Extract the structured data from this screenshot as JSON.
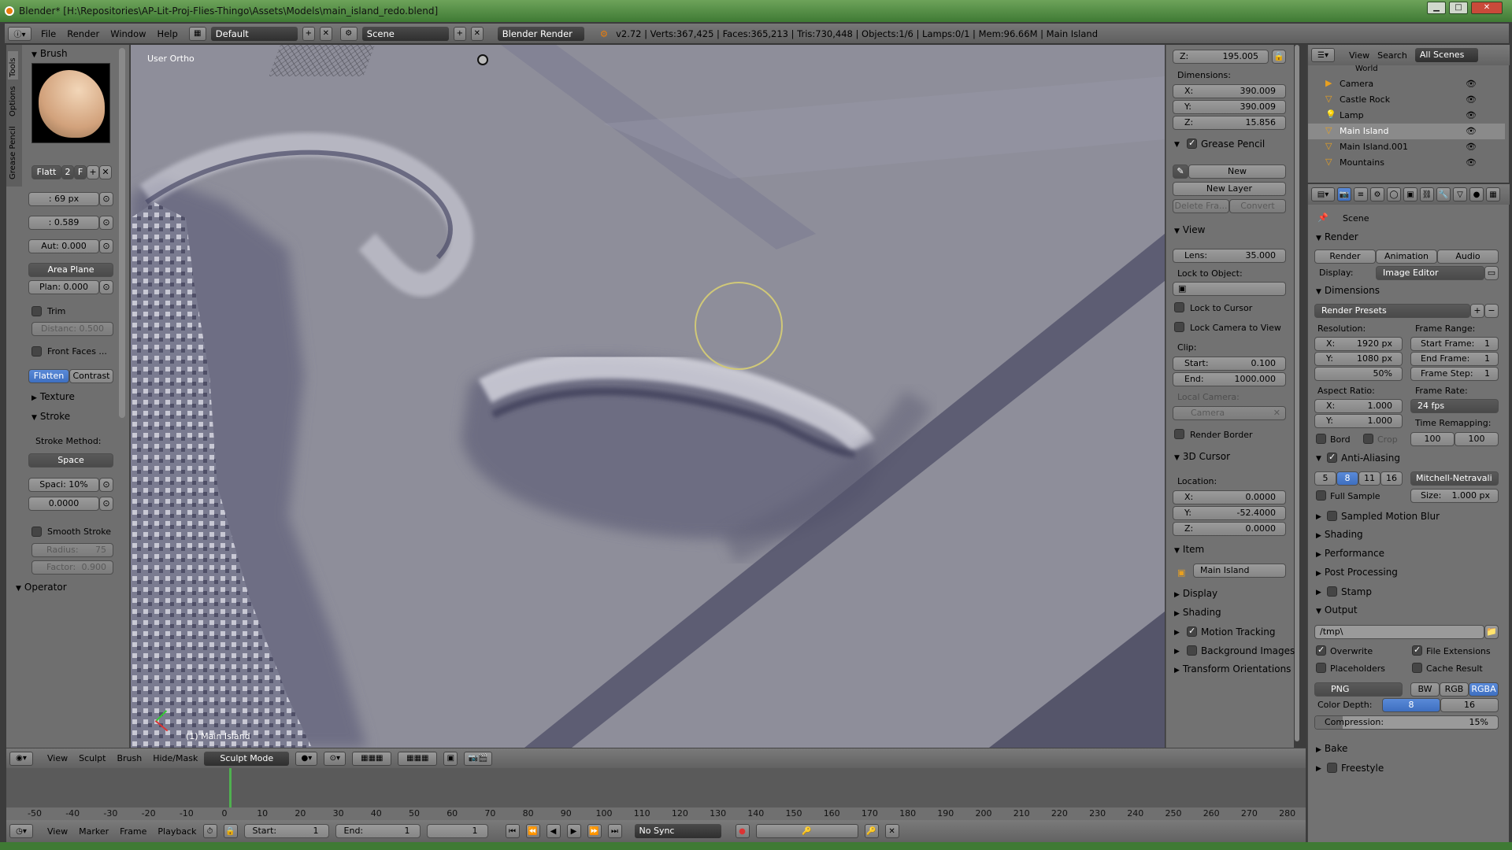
{
  "window": {
    "title": "Blender* [H:\\Repositories\\AP-Lit-Proj-Flies-Thingo\\Assets\\Models\\main_island_redo.blend]",
    "min": "▁",
    "max": "□",
    "close": "✕"
  },
  "menu": {
    "items": [
      "File",
      "Render",
      "Window",
      "Help"
    ],
    "layout": "Default",
    "scene": "Scene",
    "engine": "Blender Render",
    "stats": "v2.72 | Verts:367,425 | Faces:365,213 | Tris:730,448 | Objects:1/6 | Lamps:0/1 | Mem:96.66M | Main Island"
  },
  "tools": {
    "tabs": [
      "Tools",
      "Options",
      "Grease Pencil"
    ],
    "brush_section": "Brush",
    "brush_name": "Flatt",
    "brush_users": "2",
    "brush_fake": "F",
    "radius": ": 69 px",
    "strength": ": 0.589",
    "autosmooth": "Aut: 0.000",
    "plane": "Area Plane",
    "plane_offset": "Plan: 0.000",
    "trim": "Trim",
    "distance": "Distanc: 0.500",
    "front_faces": "Front Faces ...",
    "flatten": "Flatten",
    "contrast": "Contrast",
    "texture": "Texture",
    "stroke": "Stroke",
    "stroke_method_label": "Stroke Method:",
    "stroke_method": "Space",
    "spacing": "Spaci: 10%",
    "jitter": "0.0000",
    "smooth_stroke": "Smooth Stroke",
    "smooth_radius": "Radius:",
    "smooth_radius_val": "75",
    "smooth_factor": "Factor:",
    "smooth_factor_val": "0.900",
    "operator": "Operator"
  },
  "viewport": {
    "view_label": "User Ortho",
    "object_label": "(1) Main Island"
  },
  "npanel": {
    "z_loc": "Z:",
    "z_loc_val": "195.005",
    "dimensions": "Dimensions:",
    "dims": [
      {
        "axis": "X:",
        "val": "390.009"
      },
      {
        "axis": "Y:",
        "val": "390.009"
      },
      {
        "axis": "Z:",
        "val": "15.856"
      }
    ],
    "grease_pencil": "Grease Pencil",
    "gp_new": "New",
    "gp_new_layer": "New Layer",
    "gp_delete": "Delete Fra...",
    "gp_convert": "Convert",
    "view": "View",
    "lens": "Lens:",
    "lens_val": "35.000",
    "lock_object": "Lock to Object:",
    "lock_cursor": "Lock to Cursor",
    "lock_camera": "Lock Camera to View",
    "clip": "Clip:",
    "clip_start": "Start:",
    "clip_start_val": "0.100",
    "clip_end": "End:",
    "clip_end_val": "1000.000",
    "local_camera": "Local Camera:",
    "camera": "Camera",
    "render_border": "Render Border",
    "cursor3d": "3D Cursor",
    "location": "Location:",
    "cursor": [
      {
        "axis": "X:",
        "val": "0.0000"
      },
      {
        "axis": "Y:",
        "val": "-52.4000"
      },
      {
        "axis": "Z:",
        "val": "0.0000"
      }
    ],
    "item": "Item",
    "item_name": "Main Island",
    "display": "Display",
    "shading": "Shading",
    "motion_tracking": "Motion Tracking",
    "background_images": "Background Images",
    "transform_orientations": "Transform Orientations"
  },
  "outliner": {
    "view": "View",
    "search": "Search",
    "filter": "All Scenes",
    "world": "World",
    "items": [
      "Camera",
      "Castle Rock",
      "Lamp",
      "Main Island",
      "Main Island.001",
      "Mountains"
    ]
  },
  "properties": {
    "scene": "Scene",
    "render": "Render",
    "render_btn": "Render",
    "animation_btn": "Animation",
    "audio_btn": "Audio",
    "display": "Display:",
    "display_val": "Image Editor",
    "dimensions": "Dimensions",
    "render_presets": "Render Presets",
    "resolution": "Resolution:",
    "res_x": "X:",
    "res_x_val": "1920 px",
    "res_y": "Y:",
    "res_y_val": "1080 px",
    "res_pct": "50%",
    "frame_range": "Frame Range:",
    "start_frame": "Start Frame:",
    "start_frame_val": "1",
    "end_frame": "End Frame:",
    "end_frame_val": "1",
    "frame_step": "Frame Step:",
    "frame_step_val": "1",
    "aspect": "Aspect Ratio:",
    "asp_x": "X:",
    "asp_x_val": "1.000",
    "asp_y": "Y:",
    "asp_y_val": "1.000",
    "frame_rate": "Frame Rate:",
    "fps": "24 fps",
    "time_remap": "Time Remapping:",
    "remap_old": "100",
    "remap_new": "100",
    "bord": "Bord",
    "crop": "Crop",
    "anti_aliasing": "Anti-Aliasing",
    "aa_samples": [
      "5",
      "8",
      "11",
      "16"
    ],
    "aa_filter": "Mitchell-Netravali",
    "full_sample": "Full Sample",
    "size": "Size:",
    "size_val": "1.000 px",
    "sampled_motion_blur": "Sampled Motion Blur",
    "shading": "Shading",
    "performance": "Performance",
    "post_processing": "Post Processing",
    "stamp": "Stamp",
    "output": "Output",
    "output_path": "/tmp\\",
    "overwrite": "Overwrite",
    "file_ext": "File Extensions",
    "placeholders": "Placeholders",
    "cache_result": "Cache Result",
    "format": "PNG",
    "bw": "BW",
    "rgb": "RGB",
    "rgba": "RGBA",
    "color_depth": "Color Depth:",
    "cd8": "8",
    "cd16": "16",
    "compression": "Compression:",
    "compression_val": "15%",
    "compression_level": 0.15,
    "bake": "Bake",
    "freestyle": "Freestyle"
  },
  "header3d": {
    "view": "View",
    "sculpt": "Sculpt",
    "brush": "Brush",
    "hidemask": "Hide/Mask",
    "mode": "Sculpt Mode"
  },
  "timeline": {
    "ticks": [
      "-50",
      "-40",
      "-30",
      "-20",
      "-10",
      "0",
      "10",
      "20",
      "30",
      "40",
      "50",
      "60",
      "70",
      "80",
      "90",
      "100",
      "110",
      "120",
      "130",
      "140",
      "150",
      "160",
      "170",
      "180",
      "190",
      "200",
      "210",
      "220",
      "230",
      "240",
      "250",
      "260",
      "270",
      "280"
    ],
    "view": "View",
    "marker": "Marker",
    "frame": "Frame",
    "playback": "Playback",
    "start": "Start:",
    "start_val": "1",
    "end": "End:",
    "end_val": "1",
    "current": "1",
    "sync": "No Sync"
  },
  "colors": {
    "accent": "#5680c2",
    "viewport_bg": "#8a8a96",
    "panel": "#727272",
    "selection": "#c8c870"
  }
}
